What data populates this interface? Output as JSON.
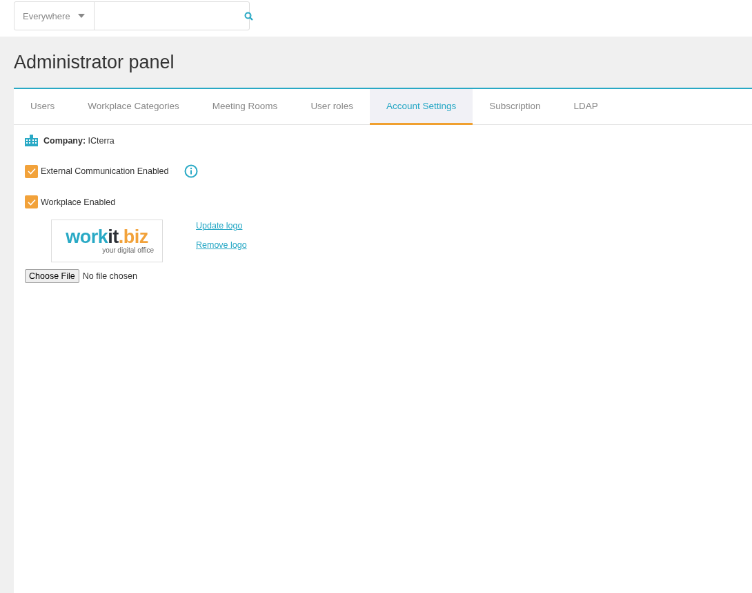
{
  "search": {
    "scope": "Everywhere"
  },
  "title": "Administrator panel",
  "tabs": [
    {
      "label": "Users",
      "selected": false
    },
    {
      "label": "Workplace Categories",
      "selected": false
    },
    {
      "label": "Meeting Rooms",
      "selected": false
    },
    {
      "label": "User roles",
      "selected": false
    },
    {
      "label": "Account Settings",
      "selected": true
    },
    {
      "label": "Subscription",
      "selected": false
    },
    {
      "label": "LDAP",
      "selected": false
    }
  ],
  "company": {
    "label": "Company:",
    "value": "ICterra"
  },
  "options": [
    {
      "label": "External Communication Enabled",
      "checked": true,
      "info": true
    },
    {
      "label": "Workplace Enabled",
      "checked": true,
      "info": false
    }
  ],
  "logo": {
    "parts": [
      {
        "text": "work",
        "color": "#29a9c5"
      },
      {
        "text": "it",
        "color": "#2b2f36"
      },
      {
        "text": ".biz",
        "color": "#f2a23a"
      }
    ],
    "tagline": "your digital office"
  },
  "logo_links": [
    "Update logo",
    "Remove logo"
  ],
  "file_input": {
    "button": "Choose File",
    "status": "No file chosen"
  }
}
